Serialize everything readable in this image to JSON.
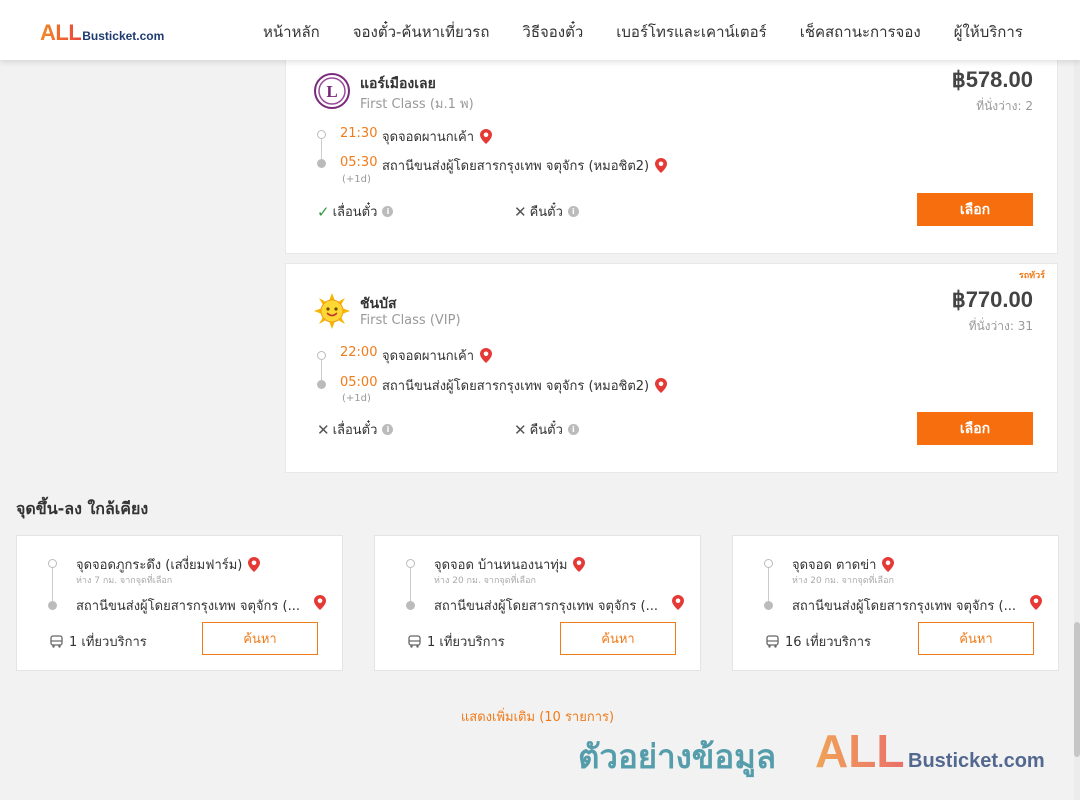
{
  "header": {
    "logo_all": "ALL",
    "logo_rest": "Busticket.com",
    "nav": [
      "หน้าหลัก",
      "จองตั๋ว-ค้นหาเที่ยวรถ",
      "วิธีจองตั๋ว",
      "เบอร์โทรและเคาน์เตอร์",
      "เช็คสถานะการจอง",
      "ผู้ให้บริการ"
    ]
  },
  "trips": [
    {
      "operator": "แอร์เมืองเลย",
      "class": "First Class (ม.1 พ)",
      "price": "฿578.00",
      "seats": "ที่นั่งว่าง: 2",
      "depart_time": "21:30",
      "depart_stop": "จุดจอดผานกเค้า",
      "arrive_time": "05:30",
      "arrive_stop": "สถานีขนส่งผู้โดยสารกรุงเทพ จตุจักร (หมอชิต2)",
      "plus_day": "(+1d)",
      "reschedule": "เลื่อนตั๋ว",
      "reschedule_ok": "✓",
      "refund": "คืนตั๋ว",
      "refund_ok": "✕",
      "select_label": "เลือก",
      "tag": ""
    },
    {
      "operator": "ชันบัส",
      "class": "First Class (VIP)",
      "price": "฿770.00",
      "seats": "ที่นั่งว่าง: 31",
      "depart_time": "22:00",
      "depart_stop": "จุดจอดผานกเค้า",
      "arrive_time": "05:00",
      "arrive_stop": "สถานีขนส่งผู้โดยสารกรุงเทพ จตุจักร (หมอชิต2)",
      "plus_day": "(+1d)",
      "reschedule": "เลื่อนตั๋ว",
      "reschedule_ok": "✕",
      "refund": "คืนตั๋ว",
      "refund_ok": "✕",
      "select_label": "เลือก",
      "tag": "รถทัวร์"
    }
  ],
  "nearby": {
    "title": "จุดขึ้น-ลง ใกล้เคียง",
    "items": [
      {
        "from": "จุดจอดภูกระดึง (เสงี่ยมฟาร์ม)",
        "distance": "ห่าง 7 กม. จากจุดที่เลือก",
        "to": "สถานีขนส่งผู้โดยสารกรุงเทพ จตุจักร (...",
        "trips": "1 เที่ยวบริการ",
        "search_label": "ค้นหา"
      },
      {
        "from": "จุดจอด บ้านหนองนาทุ่ม",
        "distance": "ห่าง 20 กม. จากจุดที่เลือก",
        "to": "สถานีขนส่งผู้โดยสารกรุงเทพ จตุจักร (...",
        "trips": "1 เที่ยวบริการ",
        "search_label": "ค้นหา"
      },
      {
        "from": "จุดจอด ตาดข่า",
        "distance": "ห่าง 20 กม. จากจุดที่เลือก",
        "to": "สถานีขนส่งผู้โดยสารกรุงเทพ จตุจักร (...",
        "trips": "16 เที่ยวบริการ",
        "search_label": "ค้นหา"
      }
    ],
    "show_more": "แสดงเพิ่มเติม (10 รายการ)"
  },
  "watermark": {
    "thai": "ตัวอย่างข้อมูล",
    "all": "ALL",
    "rest": "Busticket.com"
  },
  "colors": {
    "accent": "#f66e0d",
    "time": "#f07b1a",
    "pin": "#e53935"
  }
}
